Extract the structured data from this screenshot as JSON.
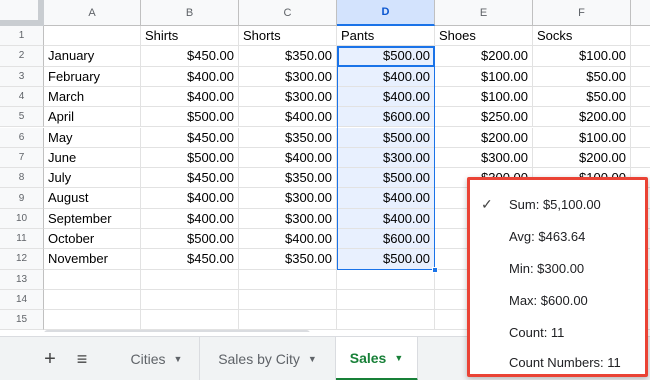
{
  "columns": [
    "A",
    "B",
    "C",
    "D",
    "E",
    "F"
  ],
  "rows": [
    "1",
    "2",
    "3",
    "4",
    "5",
    "6",
    "7",
    "8",
    "9",
    "10",
    "11",
    "12",
    "13",
    "14",
    "15"
  ],
  "header_row": [
    "",
    "Shirts",
    "Shorts",
    "Pants",
    "Shoes",
    "Socks"
  ],
  "data_rows": [
    [
      "January",
      "$450.00",
      "$350.00",
      "$500.00",
      "$200.00",
      "$100.00"
    ],
    [
      "February",
      "$400.00",
      "$300.00",
      "$400.00",
      "$100.00",
      "$50.00"
    ],
    [
      "March",
      "$400.00",
      "$300.00",
      "$400.00",
      "$100.00",
      "$50.00"
    ],
    [
      "April",
      "$500.00",
      "$400.00",
      "$600.00",
      "$250.00",
      "$200.00"
    ],
    [
      "May",
      "$450.00",
      "$350.00",
      "$500.00",
      "$200.00",
      "$100.00"
    ],
    [
      "June",
      "$500.00",
      "$400.00",
      "$300.00",
      "$300.00",
      "$200.00"
    ],
    [
      "July",
      "$450.00",
      "$350.00",
      "$500.00",
      "$300.00",
      "$100.00"
    ],
    [
      "August",
      "$400.00",
      "$300.00",
      "$400.00",
      "",
      ""
    ],
    [
      "September",
      "$400.00",
      "$300.00",
      "$400.00",
      "",
      ""
    ],
    [
      "October",
      "$500.00",
      "$400.00",
      "$600.00",
      "",
      ""
    ],
    [
      "November",
      "$450.00",
      "$350.00",
      "$500.00",
      "",
      ""
    ]
  ],
  "selected_column": "D",
  "tabbar": {
    "add_icon": "plus-icon",
    "list_icon": "list-icon",
    "tabs": [
      {
        "label": "Cities",
        "active": false
      },
      {
        "label": "Sales by City",
        "active": false
      },
      {
        "label": "Sales",
        "active": true
      }
    ]
  },
  "summary_menu": {
    "items": [
      {
        "label": "Sum: $5,100.00",
        "checked": true
      },
      {
        "label": "Avg: $463.64",
        "checked": false
      },
      {
        "label": "Min: $300.00",
        "checked": false
      },
      {
        "label": "Max: $600.00",
        "checked": false
      },
      {
        "label": "Count: 11",
        "checked": false
      },
      {
        "label": "Count Numbers: 11",
        "checked": false
      }
    ],
    "check_icon": "✓",
    "border_color": "#ea4335"
  },
  "colors": {
    "selection": "#1a73e8",
    "selection_fill": "#e8f0fe",
    "active_tab": "#188038"
  }
}
